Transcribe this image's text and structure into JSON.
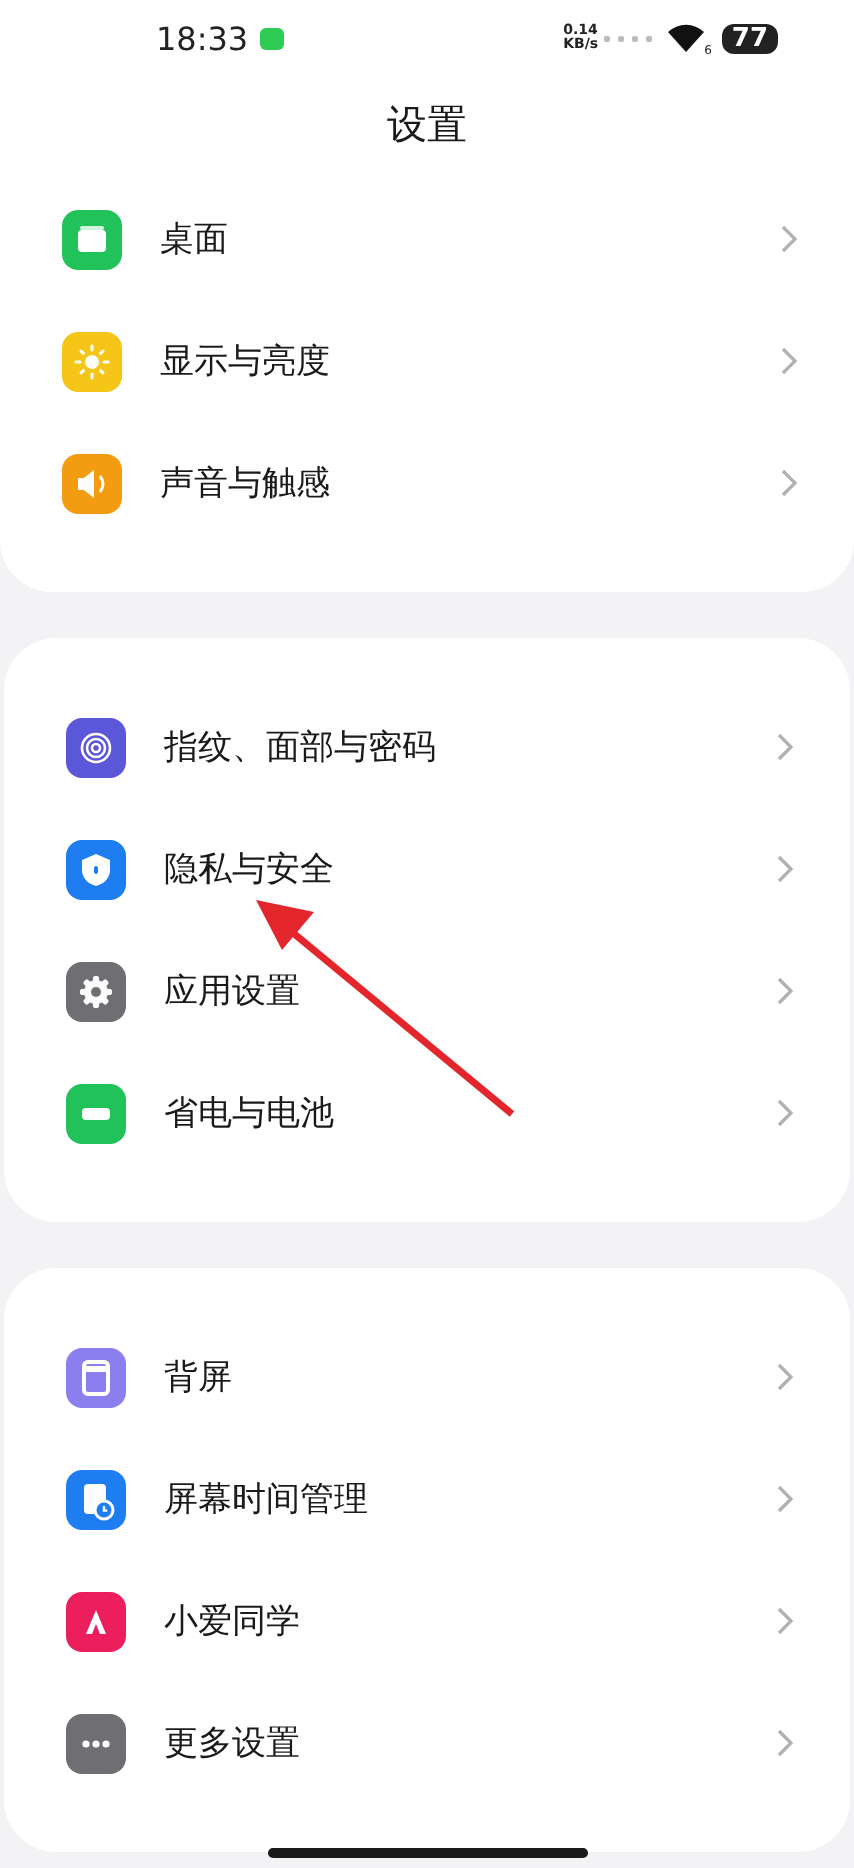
{
  "status_bar": {
    "time": "18:33",
    "speed_value": "0.14",
    "speed_unit": "KB/s",
    "wifi_label": "6",
    "battery": "77"
  },
  "title": "设置",
  "sections": [
    {
      "items": [
        {
          "label": "桌面",
          "kind": "desktop"
        },
        {
          "label": "显示与亮度",
          "kind": "sun"
        },
        {
          "label": "声音与触感",
          "kind": "speaker"
        }
      ]
    },
    {
      "items": [
        {
          "label": "指纹、面部与密码",
          "kind": "fingerprint"
        },
        {
          "label": "隐私与安全",
          "kind": "shield"
        },
        {
          "label": "应用设置",
          "kind": "gear"
        },
        {
          "label": "省电与电池",
          "kind": "battery"
        }
      ]
    },
    {
      "items": [
        {
          "label": "背屏",
          "kind": "backscreen"
        },
        {
          "label": "屏幕时间管理",
          "kind": "screentime"
        },
        {
          "label": "小爱同学",
          "kind": "assistant"
        },
        {
          "label": "更多设置",
          "kind": "more"
        }
      ]
    }
  ],
  "annotations": [
    {
      "kind": "arrow",
      "color": "#e3262b"
    }
  ]
}
